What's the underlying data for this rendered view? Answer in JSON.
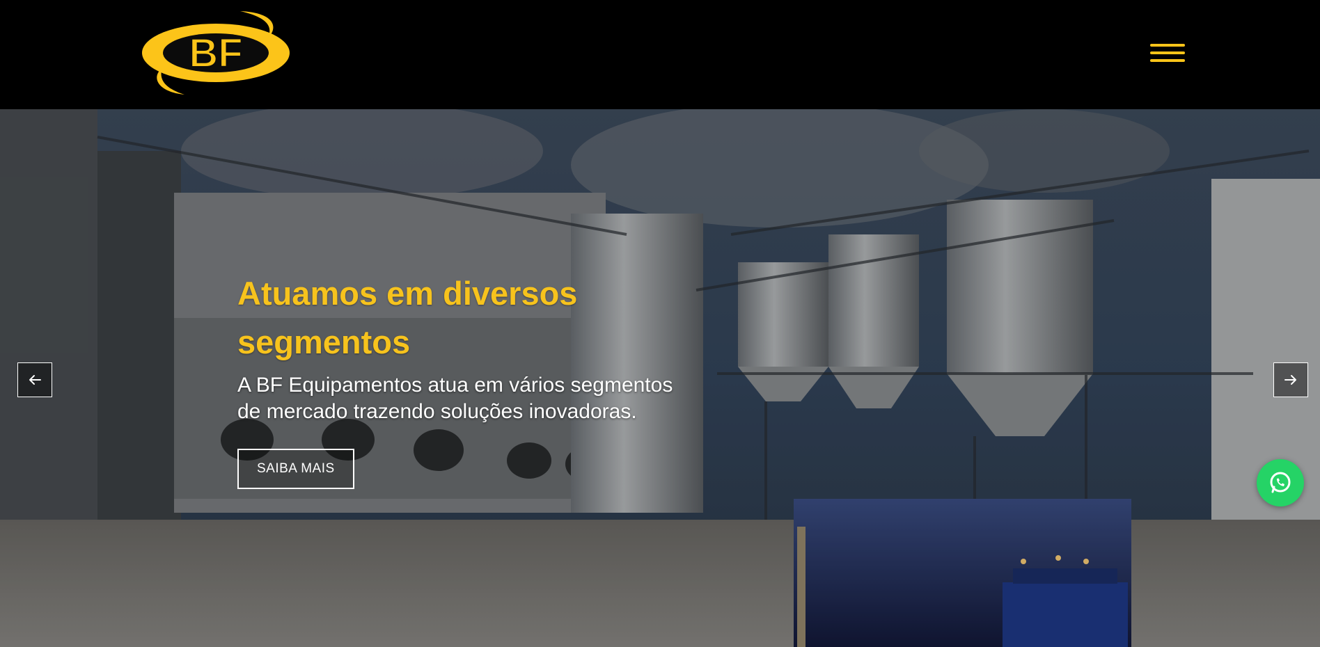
{
  "header": {
    "logo_text": "BF",
    "menu_icon": "hamburger-menu-icon",
    "accent_color": "#fcc419"
  },
  "hero": {
    "title": "Atuamos em diversos segmentos",
    "description": "A BF Equipamentos atua em vários segmentos de mercado trazendo soluções inovadoras.",
    "cta_label": "SAIBA MAIS",
    "prev_icon": "arrow-left-icon",
    "next_icon": "arrow-right-icon",
    "title_color": "#f7c31d"
  },
  "floating": {
    "whatsapp_icon": "whatsapp-icon",
    "whatsapp_color": "#25d366"
  }
}
